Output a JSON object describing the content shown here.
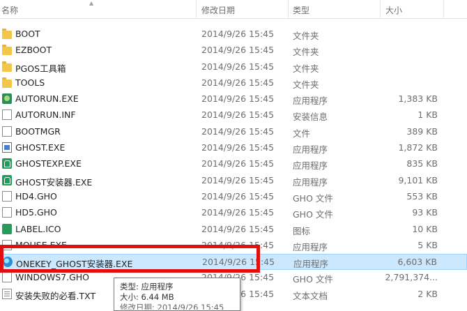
{
  "columns": {
    "name": "名称",
    "date": "修改日期",
    "type": "类型",
    "size": "大小"
  },
  "files": [
    {
      "name": "BOOT",
      "date": "2014/9/26 15:45",
      "type": "文件夹",
      "size": "",
      "icon": "folder-icon",
      "kind": "folder"
    },
    {
      "name": "EZBOOT",
      "date": "2014/9/26 15:45",
      "type": "文件夹",
      "size": "",
      "icon": "folder-icon",
      "kind": "folder"
    },
    {
      "name": "PGOS工具箱",
      "date": "2014/9/26 15:45",
      "type": "文件夹",
      "size": "",
      "icon": "folder-icon",
      "kind": "folder"
    },
    {
      "name": "TOOLS",
      "date": "2014/9/26 15:45",
      "type": "文件夹",
      "size": "",
      "icon": "folder-icon",
      "kind": "folder"
    },
    {
      "name": "AUTORUN.EXE",
      "date": "2014/9/26 15:45",
      "type": "应用程序",
      "size": "1,383 KB",
      "icon": "exe-icon",
      "kind": "exe"
    },
    {
      "name": "AUTORUN.INF",
      "date": "2014/9/26 15:45",
      "type": "安装信息",
      "size": "1 KB",
      "icon": "settings-file-icon",
      "kind": "file"
    },
    {
      "name": "BOOTMGR",
      "date": "2014/9/26 15:45",
      "type": "文件",
      "size": "389 KB",
      "icon": "file-icon",
      "kind": "file"
    },
    {
      "name": "GHOST.EXE",
      "date": "2014/9/26 15:45",
      "type": "应用程序",
      "size": "1,872 KB",
      "icon": "app-window-icon",
      "kind": "app"
    },
    {
      "name": "GHOSTEXP.EXE",
      "date": "2014/9/26 15:45",
      "type": "应用程序",
      "size": "835 KB",
      "icon": "ghost-explorer-icon",
      "kind": "ghost"
    },
    {
      "name": "GHOST安装器.EXE",
      "date": "2014/9/26 15:45",
      "type": "应用程序",
      "size": "9,101 KB",
      "icon": "ghost-installer-icon",
      "kind": "ghost"
    },
    {
      "name": "HD4.GHO",
      "date": "2014/9/26 15:45",
      "type": "GHO 文件",
      "size": "553 KB",
      "icon": "file-icon",
      "kind": "file"
    },
    {
      "name": "HD5.GHO",
      "date": "2014/9/26 15:45",
      "type": "GHO 文件",
      "size": "93 KB",
      "icon": "file-icon",
      "kind": "file"
    },
    {
      "name": "LABEL.ICO",
      "date": "2014/9/26 15:45",
      "type": "图标",
      "size": "10 KB",
      "icon": "image-icon",
      "kind": "ico"
    },
    {
      "name": "MOUSE.EXE",
      "date": "2014/9/26 15:45",
      "type": "应用程序",
      "size": "5 KB",
      "icon": "file-icon",
      "kind": "file"
    },
    {
      "name": "ONEKEY_GHOST安装器.EXE",
      "date": "2014/9/26 15:45",
      "type": "应用程序",
      "size": "6,603 KB",
      "icon": "disc-icon",
      "kind": "disc",
      "selected": true
    },
    {
      "name": "WINDOWS7.GHO",
      "date": "2014/9/26 15:45",
      "type": "GHO 文件",
      "size": "2,791,374...",
      "icon": "file-icon",
      "kind": "file"
    },
    {
      "name": "安装失败的必看.TXT",
      "date": "2014/9/26 15:45",
      "type": "文本文档",
      "size": "2 KB",
      "icon": "text-file-icon",
      "kind": "txt"
    }
  ],
  "tooltip": {
    "type_line": "类型: 应用程序",
    "size_line": "大小: 6.44 MB",
    "date_line": "修改日期: 2014/9/26 15:45"
  },
  "colors": {
    "highlight": "#e01010",
    "selection": "#cce8ff",
    "folder": "#f3c64a"
  }
}
